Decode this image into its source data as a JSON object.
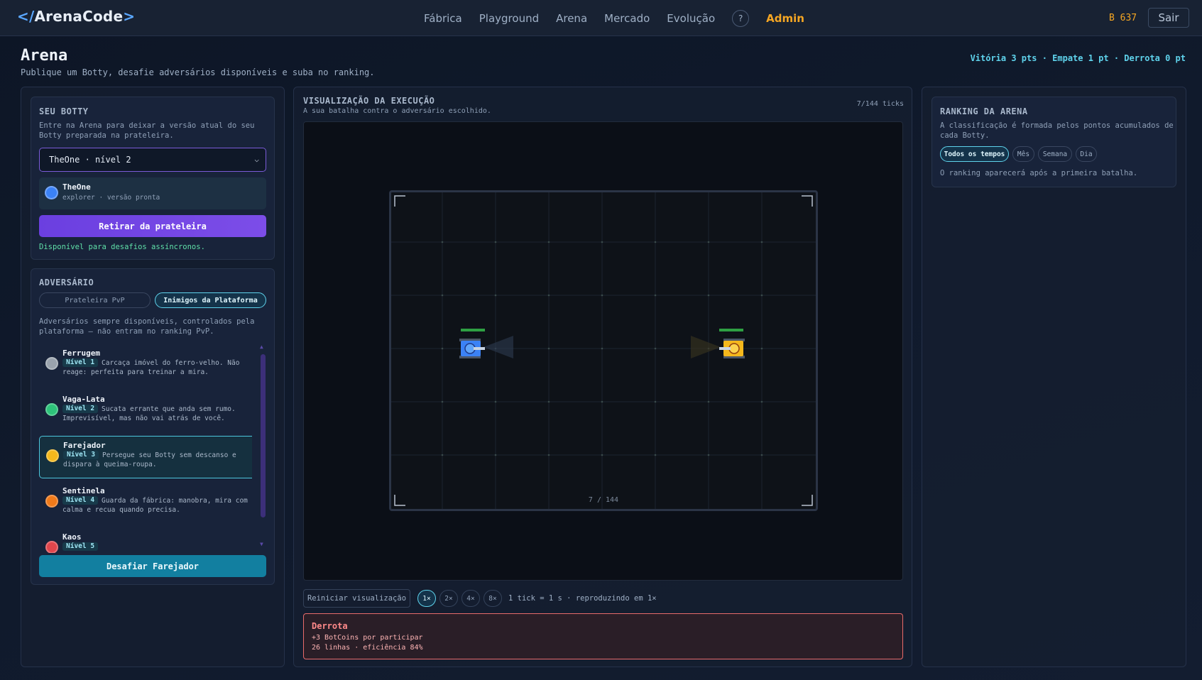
{
  "header": {
    "logo_open": "</",
    "logo_text": "ArenaCode",
    "logo_close": ">",
    "nav": [
      "Fábrica",
      "Playground",
      "Arena",
      "Mercado",
      "Evolução"
    ],
    "help": "?",
    "admin": "Admin",
    "coins": "B 637",
    "logout": "Sair"
  },
  "page": {
    "title": "Arena",
    "subtitle": "Publique um Botty, desafie adversários disponíveis e suba no ranking.",
    "scoring": "Vitória 3 pts · Empate 1 pt · Derrota 0 pt"
  },
  "botty": {
    "heading": "SEU BOTTY",
    "desc_1": "Entre na Arena para deixar a versão atual do seu",
    "desc_2": "Botty preparada na prateleira.",
    "select_value": "TheOne · nível 2",
    "bot_name": "TheOne",
    "bot_meta": "explorer · versão pronta",
    "bot_color": "#3b82f6",
    "action": "Retirar da prateleira",
    "status": "Disponível para desafios assíncronos."
  },
  "adversary": {
    "heading": "ADVERSÁRIO",
    "tabs": [
      "Prateleira PvP",
      "Inimigos da Plataforma"
    ],
    "active_tab": "Inimigos da Plataforma",
    "desc_1": "Adversários sempre disponíveis, controlados pela",
    "desc_2": "plataforma — não entram no ranking PvP.",
    "opponents": [
      {
        "name": "Ferrugem",
        "level": "Nível 1",
        "desc": "Carcaça imóvel do ferro-velho. Não reage: perfeita para treinar a mira.",
        "color": "#9aa3ad"
      },
      {
        "name": "Vaga-Lata",
        "level": "Nível 2",
        "desc": "Sucata errante que anda sem rumo. Imprevisível, mas não vai atrás de você.",
        "color": "#2ec37a"
      },
      {
        "name": "Farejador",
        "level": "Nível 3",
        "desc": "Persegue seu Botty sem descanso e dispara à queima-roupa.",
        "color": "#f5b81c"
      },
      {
        "name": "Sentinela",
        "level": "Nível 4",
        "desc": "Guarda da fábrica: manobra, mira com calma e recua quando precisa.",
        "color": "#f07a1a"
      },
      {
        "name": "Kaos",
        "level": "Nível 5",
        "desc": "",
        "color": "#e0464c"
      }
    ],
    "selected": "Farejador",
    "challenge": "Desafiar Farejador"
  },
  "visualization": {
    "heading": "VISUALIZAÇÃO DA EXECUÇÃO",
    "subtitle": "A sua batalha contra o adversário escolhido.",
    "ticks": "7/144 ticks",
    "progress_label": "7 / 144",
    "tick": 7,
    "tick_total": 144,
    "restart": "Reiniciar visualização",
    "speeds": [
      "1×",
      "2×",
      "4×",
      "8×"
    ],
    "active_speed": "1×",
    "speed_info": "1 tick = 1 s · reproduzindo em 1×",
    "player_color": "#3b82f6",
    "enemy_color": "#f5b81c"
  },
  "result": {
    "title": "Derrota",
    "line1": "+3 BotCoins por participar",
    "line2": "26 linhas · eficiência 84%"
  },
  "ranking": {
    "heading": "RANKING DA ARENA",
    "desc_1": "A classificação é formada pelos pontos acumulados de",
    "desc_2": "cada Botty.",
    "filters": [
      "Todos os tempos",
      "Mês",
      "Semana",
      "Dia"
    ],
    "active_filter": "Todos os tempos",
    "empty": "O ranking aparecerá após a primeira batalha."
  }
}
